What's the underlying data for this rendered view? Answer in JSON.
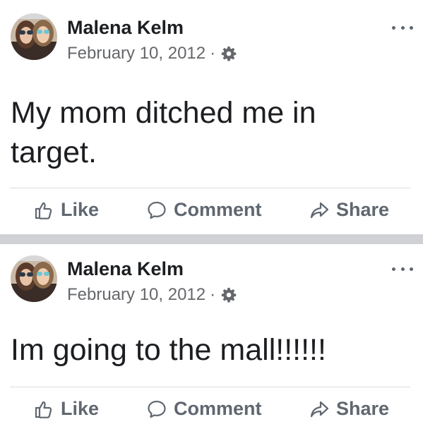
{
  "posts": [
    {
      "author": "Malena Kelm",
      "date": "February 10, 2012",
      "separator": "·",
      "privacy_icon": "gear-icon",
      "text": "My mom ditched me in target.",
      "actions": {
        "like": "Like",
        "comment": "Comment",
        "share": "Share"
      }
    },
    {
      "author": "Malena Kelm",
      "date": "February 10, 2012",
      "separator": "·",
      "privacy_icon": "gear-icon",
      "text": "Im going to the mall!!!!!!",
      "actions": {
        "like": "Like",
        "comment": "Comment",
        "share": "Share"
      }
    }
  ],
  "colors": {
    "text_primary": "#1c1e21",
    "text_secondary": "#65676b",
    "action_gray": "#606770",
    "divider": "#cfd1d5"
  }
}
